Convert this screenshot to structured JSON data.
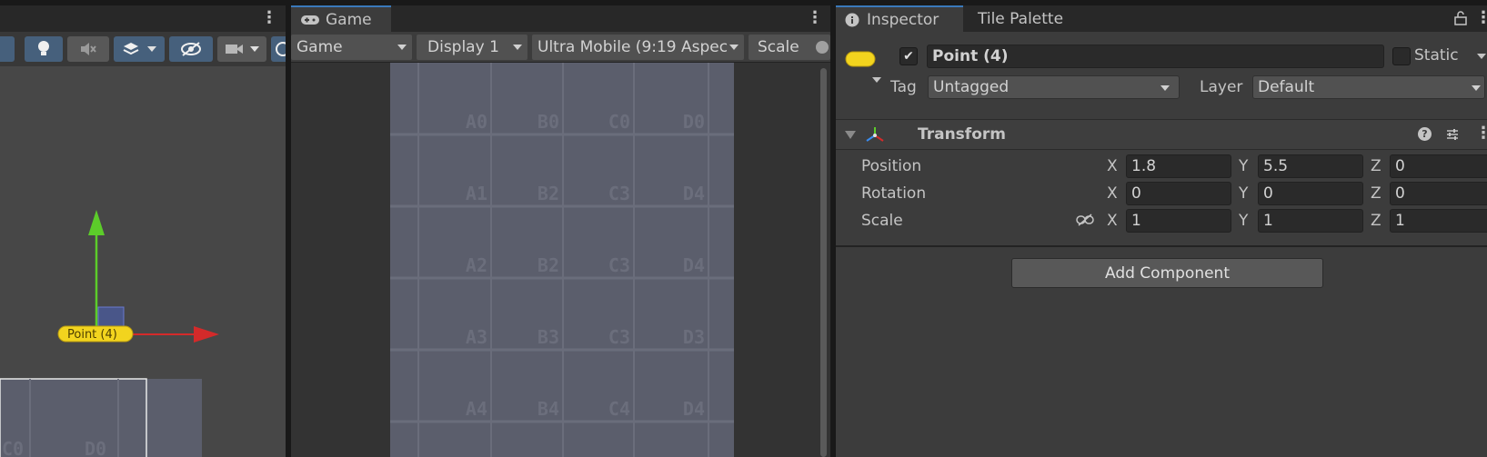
{
  "scene": {
    "object_label": "Point (4)",
    "grid_labels": [
      "C0",
      "D0"
    ]
  },
  "game": {
    "tab_label": "Game",
    "mode_dropdown": "Game",
    "display_dropdown": "Display 1",
    "aspect_dropdown": "Ultra Mobile (9:19 Aspec",
    "scale_label": "Scale",
    "cells": [
      [
        "A0",
        "B0",
        "C0",
        "D0"
      ],
      [
        "A1",
        "B2",
        "C3",
        "D4"
      ],
      [
        "A2",
        "B2",
        "C3",
        "D4"
      ],
      [
        "A3",
        "B3",
        "C3",
        "D3"
      ],
      [
        "A4",
        "B4",
        "C4",
        "D4"
      ]
    ]
  },
  "inspector": {
    "tab_label": "Inspector",
    "tile_palette_tab": "Tile Palette",
    "object_name": "Point (4)",
    "static_label": "Static",
    "tag_label": "Tag",
    "tag_value": "Untagged",
    "layer_label": "Layer",
    "layer_value": "Default",
    "transform_title": "Transform",
    "position_label": "Position",
    "rotation_label": "Rotation",
    "scale_label": "Scale",
    "axis_x": "X",
    "axis_y": "Y",
    "axis_z": "Z",
    "position": {
      "x": "1.8",
      "y": "5.5",
      "z": "0"
    },
    "rotation": {
      "x": "0",
      "y": "0",
      "z": "0"
    },
    "scale": {
      "x": "1",
      "y": "1",
      "z": "1"
    },
    "add_component": "Add Component",
    "help_glyph": "?"
  },
  "colors": {
    "accent": "#3a79bb",
    "gizmo_x": "#d42a2a",
    "gizmo_y": "#5ccc2a",
    "object_yellow": "#f2d41e"
  }
}
